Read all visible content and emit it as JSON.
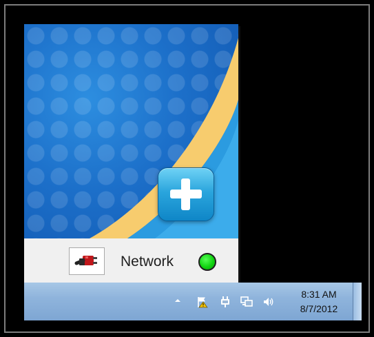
{
  "popup": {
    "logo_icon": "plus-icon",
    "status": {
      "app_icon": "network-app-icon",
      "label": "Network",
      "indicator_color": "#11d411"
    }
  },
  "taskbar": {
    "tray": {
      "show_hidden_icon": "chevron-up-icon",
      "items": [
        "action-center-flag-icon",
        "power-plug-icon",
        "network-icon",
        "volume-icon"
      ]
    },
    "clock": {
      "time": "8:31 AM",
      "date": "8/7/2012"
    }
  }
}
